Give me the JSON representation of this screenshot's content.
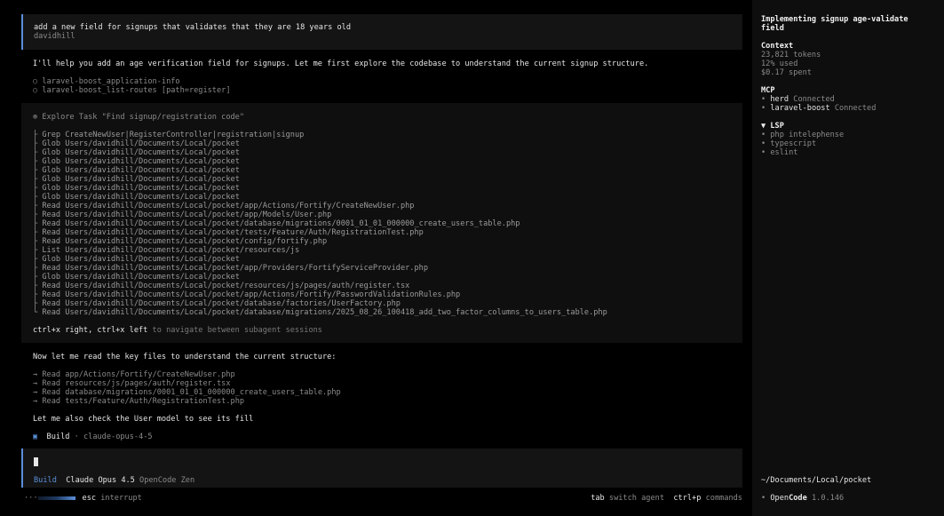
{
  "user_message": {
    "text": "add a new field for signups that validates that they are 18 years old",
    "author": "davidhill"
  },
  "assistant_intro": "I'll help you add an age verification field for signups. Let me first explore the codebase to understand the current signup structure.",
  "tool_calls": [
    {
      "icon": "○",
      "text": "laravel-boost_application-info"
    },
    {
      "icon": "○",
      "text": "laravel-boost_list-routes [path=register]"
    }
  ],
  "task": {
    "icon": "⊛",
    "title": "Explore Task \"Find signup/registration code\"",
    "steps": [
      {
        "branch": "├",
        "verb": "Grep",
        "arg": "CreateNewUser|RegisterController|registration|signup"
      },
      {
        "branch": "├",
        "verb": "Glob",
        "arg": "Users/davidhill/Documents/Local/pocket"
      },
      {
        "branch": "├",
        "verb": "Glob",
        "arg": "Users/davidhill/Documents/Local/pocket"
      },
      {
        "branch": "├",
        "verb": "Glob",
        "arg": "Users/davidhill/Documents/Local/pocket"
      },
      {
        "branch": "├",
        "verb": "Glob",
        "arg": "Users/davidhill/Documents/Local/pocket"
      },
      {
        "branch": "├",
        "verb": "Glob",
        "arg": "Users/davidhill/Documents/Local/pocket"
      },
      {
        "branch": "├",
        "verb": "Glob",
        "arg": "Users/davidhill/Documents/Local/pocket"
      },
      {
        "branch": "├",
        "verb": "Glob",
        "arg": "Users/davidhill/Documents/Local/pocket"
      },
      {
        "branch": "├",
        "verb": "Read",
        "arg": "Users/davidhill/Documents/Local/pocket/app/Actions/Fortify/CreateNewUser.php"
      },
      {
        "branch": "├",
        "verb": "Read",
        "arg": "Users/davidhill/Documents/Local/pocket/app/Models/User.php"
      },
      {
        "branch": "├",
        "verb": "Read",
        "arg": "Users/davidhill/Documents/Local/pocket/database/migrations/0001_01_01_000000_create_users_table.php"
      },
      {
        "branch": "├",
        "verb": "Read",
        "arg": "Users/davidhill/Documents/Local/pocket/tests/Feature/Auth/RegistrationTest.php"
      },
      {
        "branch": "├",
        "verb": "Read",
        "arg": "Users/davidhill/Documents/Local/pocket/config/fortify.php"
      },
      {
        "branch": "├",
        "verb": "List",
        "arg": "Users/davidhill/Documents/Local/pocket/resources/js"
      },
      {
        "branch": "├",
        "verb": "Glob",
        "arg": "Users/davidhill/Documents/Local/pocket"
      },
      {
        "branch": "├",
        "verb": "Read",
        "arg": "Users/davidhill/Documents/Local/pocket/app/Providers/FortifyServiceProvider.php"
      },
      {
        "branch": "├",
        "verb": "Glob",
        "arg": "Users/davidhill/Documents/Local/pocket"
      },
      {
        "branch": "├",
        "verb": "Read",
        "arg": "Users/davidhill/Documents/Local/pocket/resources/js/pages/auth/register.tsx"
      },
      {
        "branch": "├",
        "verb": "Read",
        "arg": "Users/davidhill/Documents/Local/pocket/app/Actions/Fortify/PasswordValidationRules.php"
      },
      {
        "branch": "├",
        "verb": "Read",
        "arg": "Users/davidhill/Documents/Local/pocket/database/factories/UserFactory.php"
      },
      {
        "branch": "└",
        "verb": "Read",
        "arg": "Users/davidhill/Documents/Local/pocket/database/migrations/2025_08_26_100418_add_two_factor_columns_to_users_table.php"
      }
    ],
    "hint_keys": "ctrl+x right, ctrl+x left",
    "hint_text": "to navigate between subagent sessions"
  },
  "followup_intro": "Now let me read the key files to understand the current structure:",
  "reads": [
    {
      "arrow": "→",
      "verb": "Read",
      "arg": "app/Actions/Fortify/CreateNewUser.php"
    },
    {
      "arrow": "→",
      "verb": "Read",
      "arg": "resources/js/pages/auth/register.tsx"
    },
    {
      "arrow": "→",
      "verb": "Read",
      "arg": "database/migrations/0001_01_01_000000_create_users_table.php"
    },
    {
      "arrow": "→",
      "verb": "Read",
      "arg": "tests/Feature/Auth/RegistrationTest.php"
    }
  ],
  "followup_text": "Let me also check the User model to see its fill",
  "build_status": {
    "icon": "▣",
    "label": "Build",
    "sep": "·",
    "model": "claude-opus-4-5"
  },
  "input": {
    "agent": "Build",
    "model": "Claude Opus 4.5",
    "provider": "OpenCode Zen"
  },
  "status_bar": {
    "dots": "···",
    "esc_key": "esc",
    "esc_label": "interrupt",
    "tab_key": "tab",
    "tab_label": "switch agent",
    "cmd_key": "ctrl+p",
    "cmd_label": "commands"
  },
  "sidebar": {
    "title_line1": "Implementing signup age-validate",
    "title_line2": "field",
    "context_heading": "Context",
    "tokens": "23,821 tokens",
    "used": "12% used",
    "spent": "$0.17 spent",
    "mcp_heading": "MCP",
    "mcp": [
      {
        "name": "herd",
        "status": "Connected"
      },
      {
        "name": "laravel-boost",
        "status": "Connected"
      }
    ],
    "lsp_heading": "▼ LSP",
    "lsp": [
      "php intelephense",
      "typescript",
      "eslint"
    ],
    "path": "~/Documents/Local/pocket",
    "brand_open": "Open",
    "brand_code": "Code",
    "version": "1.0.146",
    "colors": {
      "accent": "#5b8fd9",
      "status_dot": "#6b6b6b"
    }
  }
}
